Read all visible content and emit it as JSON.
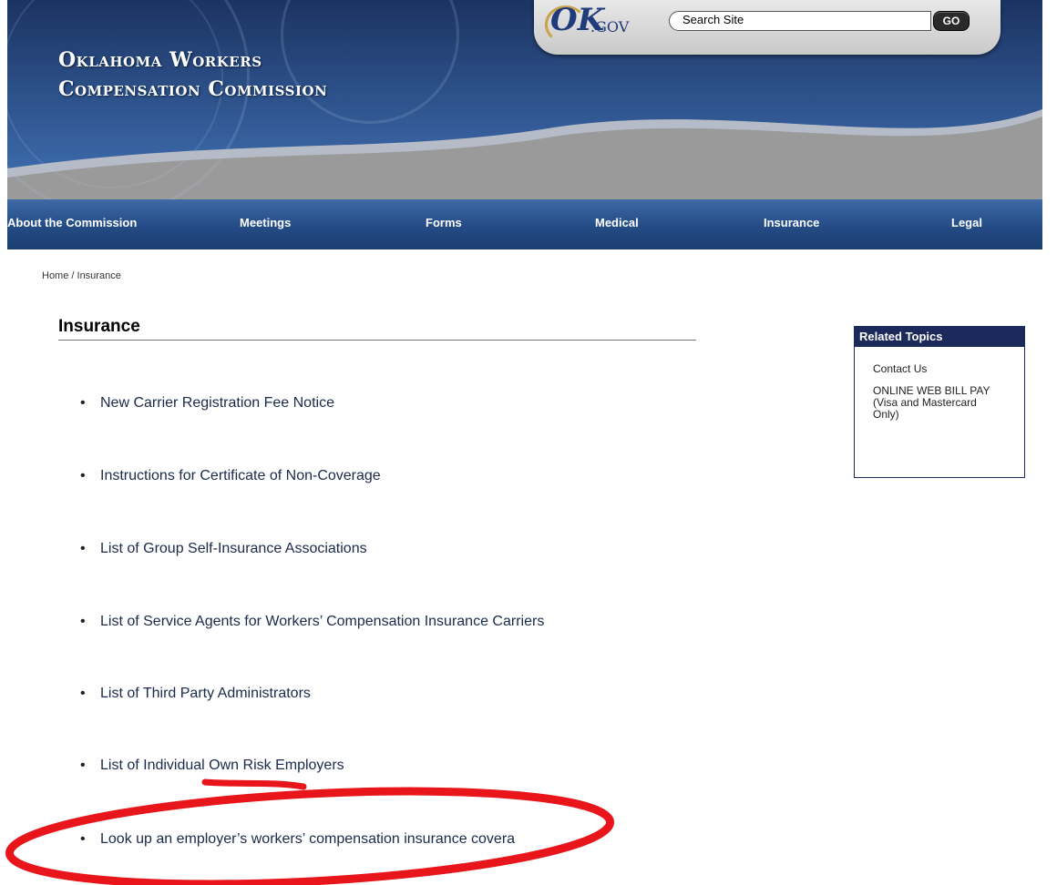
{
  "header": {
    "title_line1": "Oklahoma Workers",
    "title_line2": "Compensation Commission",
    "ok_logo": "OK",
    "gov_logo": ".GOV",
    "search_placeholder": "Search Site",
    "search_button": "GO"
  },
  "nav": {
    "items": [
      {
        "label": "About the Commission"
      },
      {
        "label": "Meetings"
      },
      {
        "label": "Forms"
      },
      {
        "label": "Medical"
      },
      {
        "label": "Insurance"
      },
      {
        "label": "Legal"
      }
    ]
  },
  "breadcrumb": "Home / Insurance",
  "main": {
    "title": "Insurance",
    "links": [
      "New Carrier Registration Fee Notice",
      "Instructions for Certificate of Non-Coverage",
      "List of Group Self-Insurance Associations",
      "List of Service Agents for Workers’ Compensation Insurance Carriers",
      "List of Third Party Administrators",
      "List of Individual Own Risk Employers",
      "Look up an employer’s workers’ compensation insurance covera"
    ]
  },
  "related": {
    "heading": "Related Topics",
    "items": [
      "Contact Us",
      "ONLINE WEB BILL PAY",
      "(Visa and Mastercard",
      "Only)"
    ]
  },
  "colors": {
    "nav_blue": "#244b85",
    "related_header": "#1b2a5a",
    "annotation_red": "#e8151b"
  },
  "icons": {
    "bullet": "•"
  }
}
